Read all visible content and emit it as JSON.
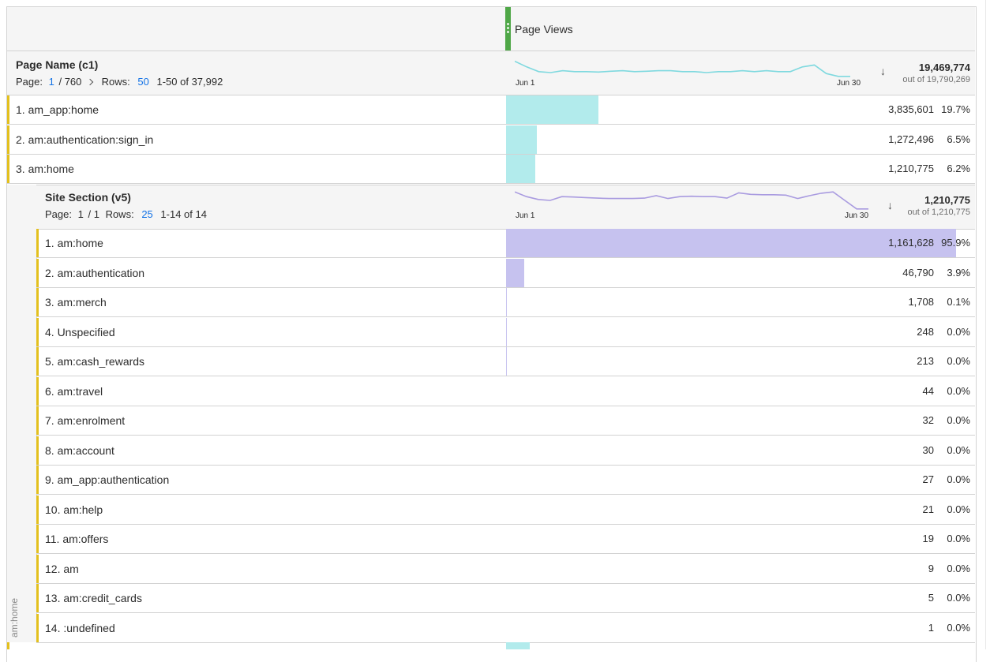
{
  "metric": {
    "title": "Page Views"
  },
  "dimension": {
    "title": "Page Name (c1)",
    "page_label": "Page:",
    "page_current": "1",
    "page_total": "/ 760",
    "rows_label": "Rows:",
    "rows_value": "50",
    "range": "1-50 of 37,992",
    "total": "19,469,774",
    "total_of": "out of 19,790,269",
    "spark_start": "Jun 1",
    "spark_end": "Jun 30",
    "spark_color": "#7fd9df",
    "spark_values": [
      0.85,
      0.55,
      0.3,
      0.25,
      0.35,
      0.3,
      0.3,
      0.28,
      0.32,
      0.35,
      0.3,
      0.32,
      0.35,
      0.35,
      0.3,
      0.3,
      0.25,
      0.3,
      0.3,
      0.35,
      0.3,
      0.35,
      0.3,
      0.3,
      0.55,
      0.65,
      0.2,
      0.05,
      0.05
    ],
    "bar_color": "#b2ebec",
    "rows": [
      {
        "label": "1.  am_app:home",
        "value": "3,835,601",
        "pct": "19.7%",
        "share": 0.197
      },
      {
        "label": "2.  am:authentication:sign_in",
        "value": "1,272,496",
        "pct": "6.5%",
        "share": 0.065
      },
      {
        "label": "3.  am:home",
        "value": "1,210,775",
        "pct": "6.2%",
        "share": 0.062
      }
    ]
  },
  "breakdown": {
    "title": "Site Section (v5)",
    "page_label": "Page:",
    "page_current": "1",
    "page_total": "/ 1",
    "rows_label": "Rows:",
    "rows_value": "25",
    "range": "1-14 of 14",
    "total": "1,210,775",
    "total_of": "out of 1,210,775",
    "spark_start": "Jun 1",
    "spark_end": "Jun 30",
    "spark_color": "#a99be0",
    "spark_values": [
      0.95,
      0.7,
      0.55,
      0.5,
      0.7,
      0.68,
      0.65,
      0.62,
      0.6,
      0.6,
      0.6,
      0.62,
      0.75,
      0.6,
      0.7,
      0.72,
      0.7,
      0.7,
      0.62,
      0.9,
      0.82,
      0.8,
      0.8,
      0.78,
      0.6,
      0.75,
      0.88,
      0.95,
      0.5,
      0.05,
      0.05
    ],
    "bar_color": "#c6c2ef",
    "sidebar_label": "am:home",
    "rows": [
      {
        "label": "1.  am:home",
        "value": "1,161,628",
        "pct": "95.9%",
        "share": 0.959
      },
      {
        "label": "2.  am:authentication",
        "value": "46,790",
        "pct": "3.9%",
        "share": 0.039
      },
      {
        "label": "3.  am:merch",
        "value": "1,708",
        "pct": "0.1%",
        "share": 0.0014
      },
      {
        "label": "4.  Unspecified",
        "value": "248",
        "pct": "0.0%",
        "share": 0.0002
      },
      {
        "label": "5.  am:cash_rewards",
        "value": "213",
        "pct": "0.0%",
        "share": 0.0002
      },
      {
        "label": "6.  am:travel",
        "value": "44",
        "pct": "0.0%",
        "share": 0
      },
      {
        "label": "7.  am:enrolment",
        "value": "32",
        "pct": "0.0%",
        "share": 0
      },
      {
        "label": "8.  am:account",
        "value": "30",
        "pct": "0.0%",
        "share": 0
      },
      {
        "label": "9.  am_app:authentication",
        "value": "27",
        "pct": "0.0%",
        "share": 0
      },
      {
        "label": "10.  am:help",
        "value": "21",
        "pct": "0.0%",
        "share": 0
      },
      {
        "label": "11.  am:offers",
        "value": "19",
        "pct": "0.0%",
        "share": 0
      },
      {
        "label": "12.  am",
        "value": "9",
        "pct": "0.0%",
        "share": 0
      },
      {
        "label": "13.  am:credit_cards",
        "value": "5",
        "pct": "0.0%",
        "share": 0
      },
      {
        "label": "14.  :undefined",
        "value": "1",
        "pct": "0.0%",
        "share": 0
      }
    ]
  },
  "next_row": {
    "share": 0.05
  }
}
